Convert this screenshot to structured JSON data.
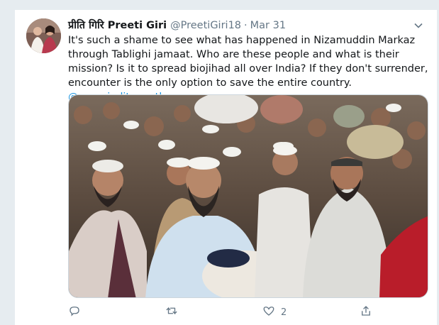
{
  "tweet": {
    "display_name": "प्रीति गिरि Preeti Giri",
    "handle": "@PreetiGiri18",
    "separator": "·",
    "date": "Mar 31",
    "body": "It's such a shame to see what has happened in Nizamuddin Markaz through Tablighi jamaat. Who are these people and what is their mission? Is it to spread biojihad all over India? If they don't surrender, encounter is the only option to save the entire country.",
    "mention": "@myogiadityanath",
    "media_description": "Photo of a crowd of men wearing white caps and carrying bundles",
    "actions": {
      "reply_count": "",
      "retweet_count": "",
      "like_count": "2",
      "share_count": ""
    }
  },
  "colors": {
    "link": "#1b95e0",
    "secondary_text": "#657786",
    "background": "#e6ecf0"
  },
  "icons": [
    "chevron-down-icon",
    "reply-icon",
    "retweet-icon",
    "heart-icon",
    "share-icon"
  ]
}
